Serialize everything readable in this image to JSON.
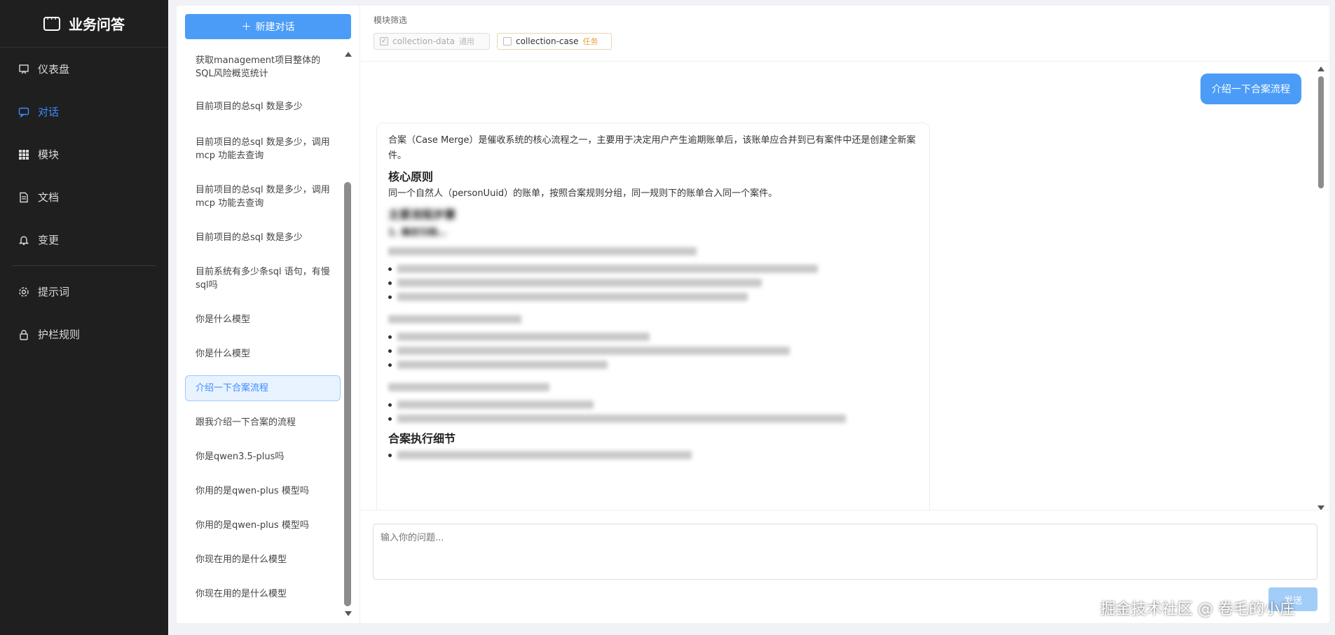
{
  "app": {
    "title": "业务问答",
    "logo_icon": "chat-bubble-icon"
  },
  "nav": {
    "items": [
      {
        "label": "仪表盘",
        "icon": "dashboard-icon"
      },
      {
        "label": "对话",
        "icon": "chat-icon",
        "active": true
      },
      {
        "label": "模块",
        "icon": "grid-icon"
      },
      {
        "label": "文档",
        "icon": "document-icon"
      },
      {
        "label": "变更",
        "icon": "bell-icon"
      }
    ],
    "secondary": [
      {
        "label": "提示词",
        "icon": "gear-icon"
      },
      {
        "label": "护栏规则",
        "icon": "lock-icon"
      }
    ]
  },
  "conversations": {
    "new_label": "新建对话",
    "items": [
      {
        "label": "获取management项目整体的SQL风险概览统计"
      },
      {
        "label": "目前项目的总sql 数是多少"
      },
      {
        "label": "目前项目的总sql 数是多少，调用mcp 功能去查询"
      },
      {
        "label": "目前项目的总sql 数是多少，调用mcp 功能去查询"
      },
      {
        "label": "目前项目的总sql 数是多少"
      },
      {
        "label": "目前系统有多少条sql 语句，有慢sql吗"
      },
      {
        "label": "你是什么模型"
      },
      {
        "label": "你是什么模型"
      },
      {
        "label": "介绍一下合案流程",
        "active": true
      },
      {
        "label": "跟我介绍一下合案的流程"
      },
      {
        "label": "你是qwen3.5-plus吗"
      },
      {
        "label": "你用的是qwen-plus 模型吗"
      },
      {
        "label": "你用的是qwen-plus 模型吗"
      },
      {
        "label": "你现在用的是什么模型"
      },
      {
        "label": "你现在用的是什么模型"
      }
    ]
  },
  "filter": {
    "label": "模块筛选",
    "chips": [
      {
        "name": "collection-data",
        "tag": "通用",
        "checked": true
      },
      {
        "name": "collection-case",
        "tag": "任务",
        "checked": false
      }
    ]
  },
  "chat": {
    "user_message": "介绍一下合案流程",
    "bot": {
      "intro": "合案（Case Merge）是催收系统的核心流程之一，主要用于决定用户产生逾期账单后，该账单应合并到已有案件中还是创建全新案件。",
      "h_core": "核心原则",
      "core_text": "同一个自然人（personUuid）的账单，按照合案规则分组，同一规则下的账单合入同一个案件。",
      "h_steps": "主要流程步骤",
      "step1": "1. 确定归档…",
      "h_detail": "合案执行细节"
    },
    "input_placeholder": "输入你的问题...",
    "send_label": "发送"
  },
  "watermark": "掘金技术社区 @ 卷毛的小庄",
  "colors": {
    "accent": "#4b9cf7",
    "nav_bg": "#1f1f1f",
    "active_nav": "#3b8bff"
  }
}
